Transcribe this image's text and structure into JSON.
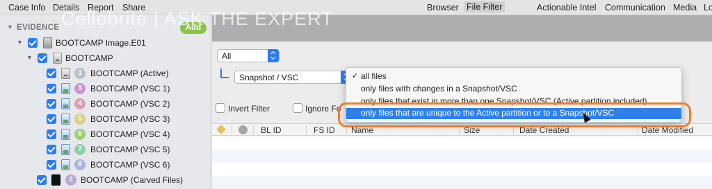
{
  "menubar": {
    "left_items": [
      "Case Info",
      "Details",
      "Report",
      "Share"
    ],
    "view_items": [
      "Browser",
      "File Filter"
    ],
    "right_items": [
      "Actionable Intel",
      "Communication",
      "Media",
      "Lo"
    ]
  },
  "watermark": "Cellebrite  |  ASK THE EXPERT",
  "evidence": {
    "header": "EVIDENCE",
    "add_label": "Add",
    "tree": [
      {
        "label": "BOOTCAMP Image.E01"
      },
      {
        "label": "BOOTCAMP"
      },
      {
        "badge": "1",
        "label": "BOOTCAMP (Active)",
        "badge_color": "#b9c0c9"
      },
      {
        "badge": "3",
        "label": "BOOTCAMP (VSC 1)",
        "badge_color": "#c998cf"
      },
      {
        "badge": "4",
        "label": "BOOTCAMP (VSC 2)",
        "badge_color": "#d9a0b0"
      },
      {
        "badge": "5",
        "label": "BOOTCAMP (VSC 3)",
        "badge_color": "#d9cf86"
      },
      {
        "badge": "6",
        "label": "BOOTCAMP (VSC 4)",
        "badge_color": "#9fcf7c"
      },
      {
        "badge": "7",
        "label": "BOOTCAMP (VSC 5)",
        "badge_color": "#8fcfae"
      },
      {
        "badge": "8",
        "label": "BOOTCAMP (VSC 6)",
        "badge_color": "#a9b8d6"
      },
      {
        "badge": "2",
        "label": "BOOTCAMP (Carved Files)",
        "badge_color": "#b9a8d6"
      }
    ]
  },
  "filters": {
    "all_select": "All",
    "snapshot_select": "Snapshot / VSC",
    "invert_filter": "Invert Filter",
    "ignore_prefix": "Ignore Fo"
  },
  "dropdown": {
    "items": [
      "all files",
      "only files with changes in a Snapshot/VSC",
      "only files that exist in more than one Snapshot/VSC (Active partition included)",
      "only files that are unique to the Active partition or to a Snapshot/VSC"
    ],
    "checked_index": 0,
    "check_mark": "✓",
    "highlighted_index": 3
  },
  "table": {
    "columns": [
      "BL ID",
      "FS ID",
      "Name",
      "Size",
      "Date Created",
      "Date Modified"
    ]
  },
  "colors": {
    "accent": "#2c7bf2",
    "callout": "#ef7d2d",
    "add_button": "#8bc34a"
  }
}
